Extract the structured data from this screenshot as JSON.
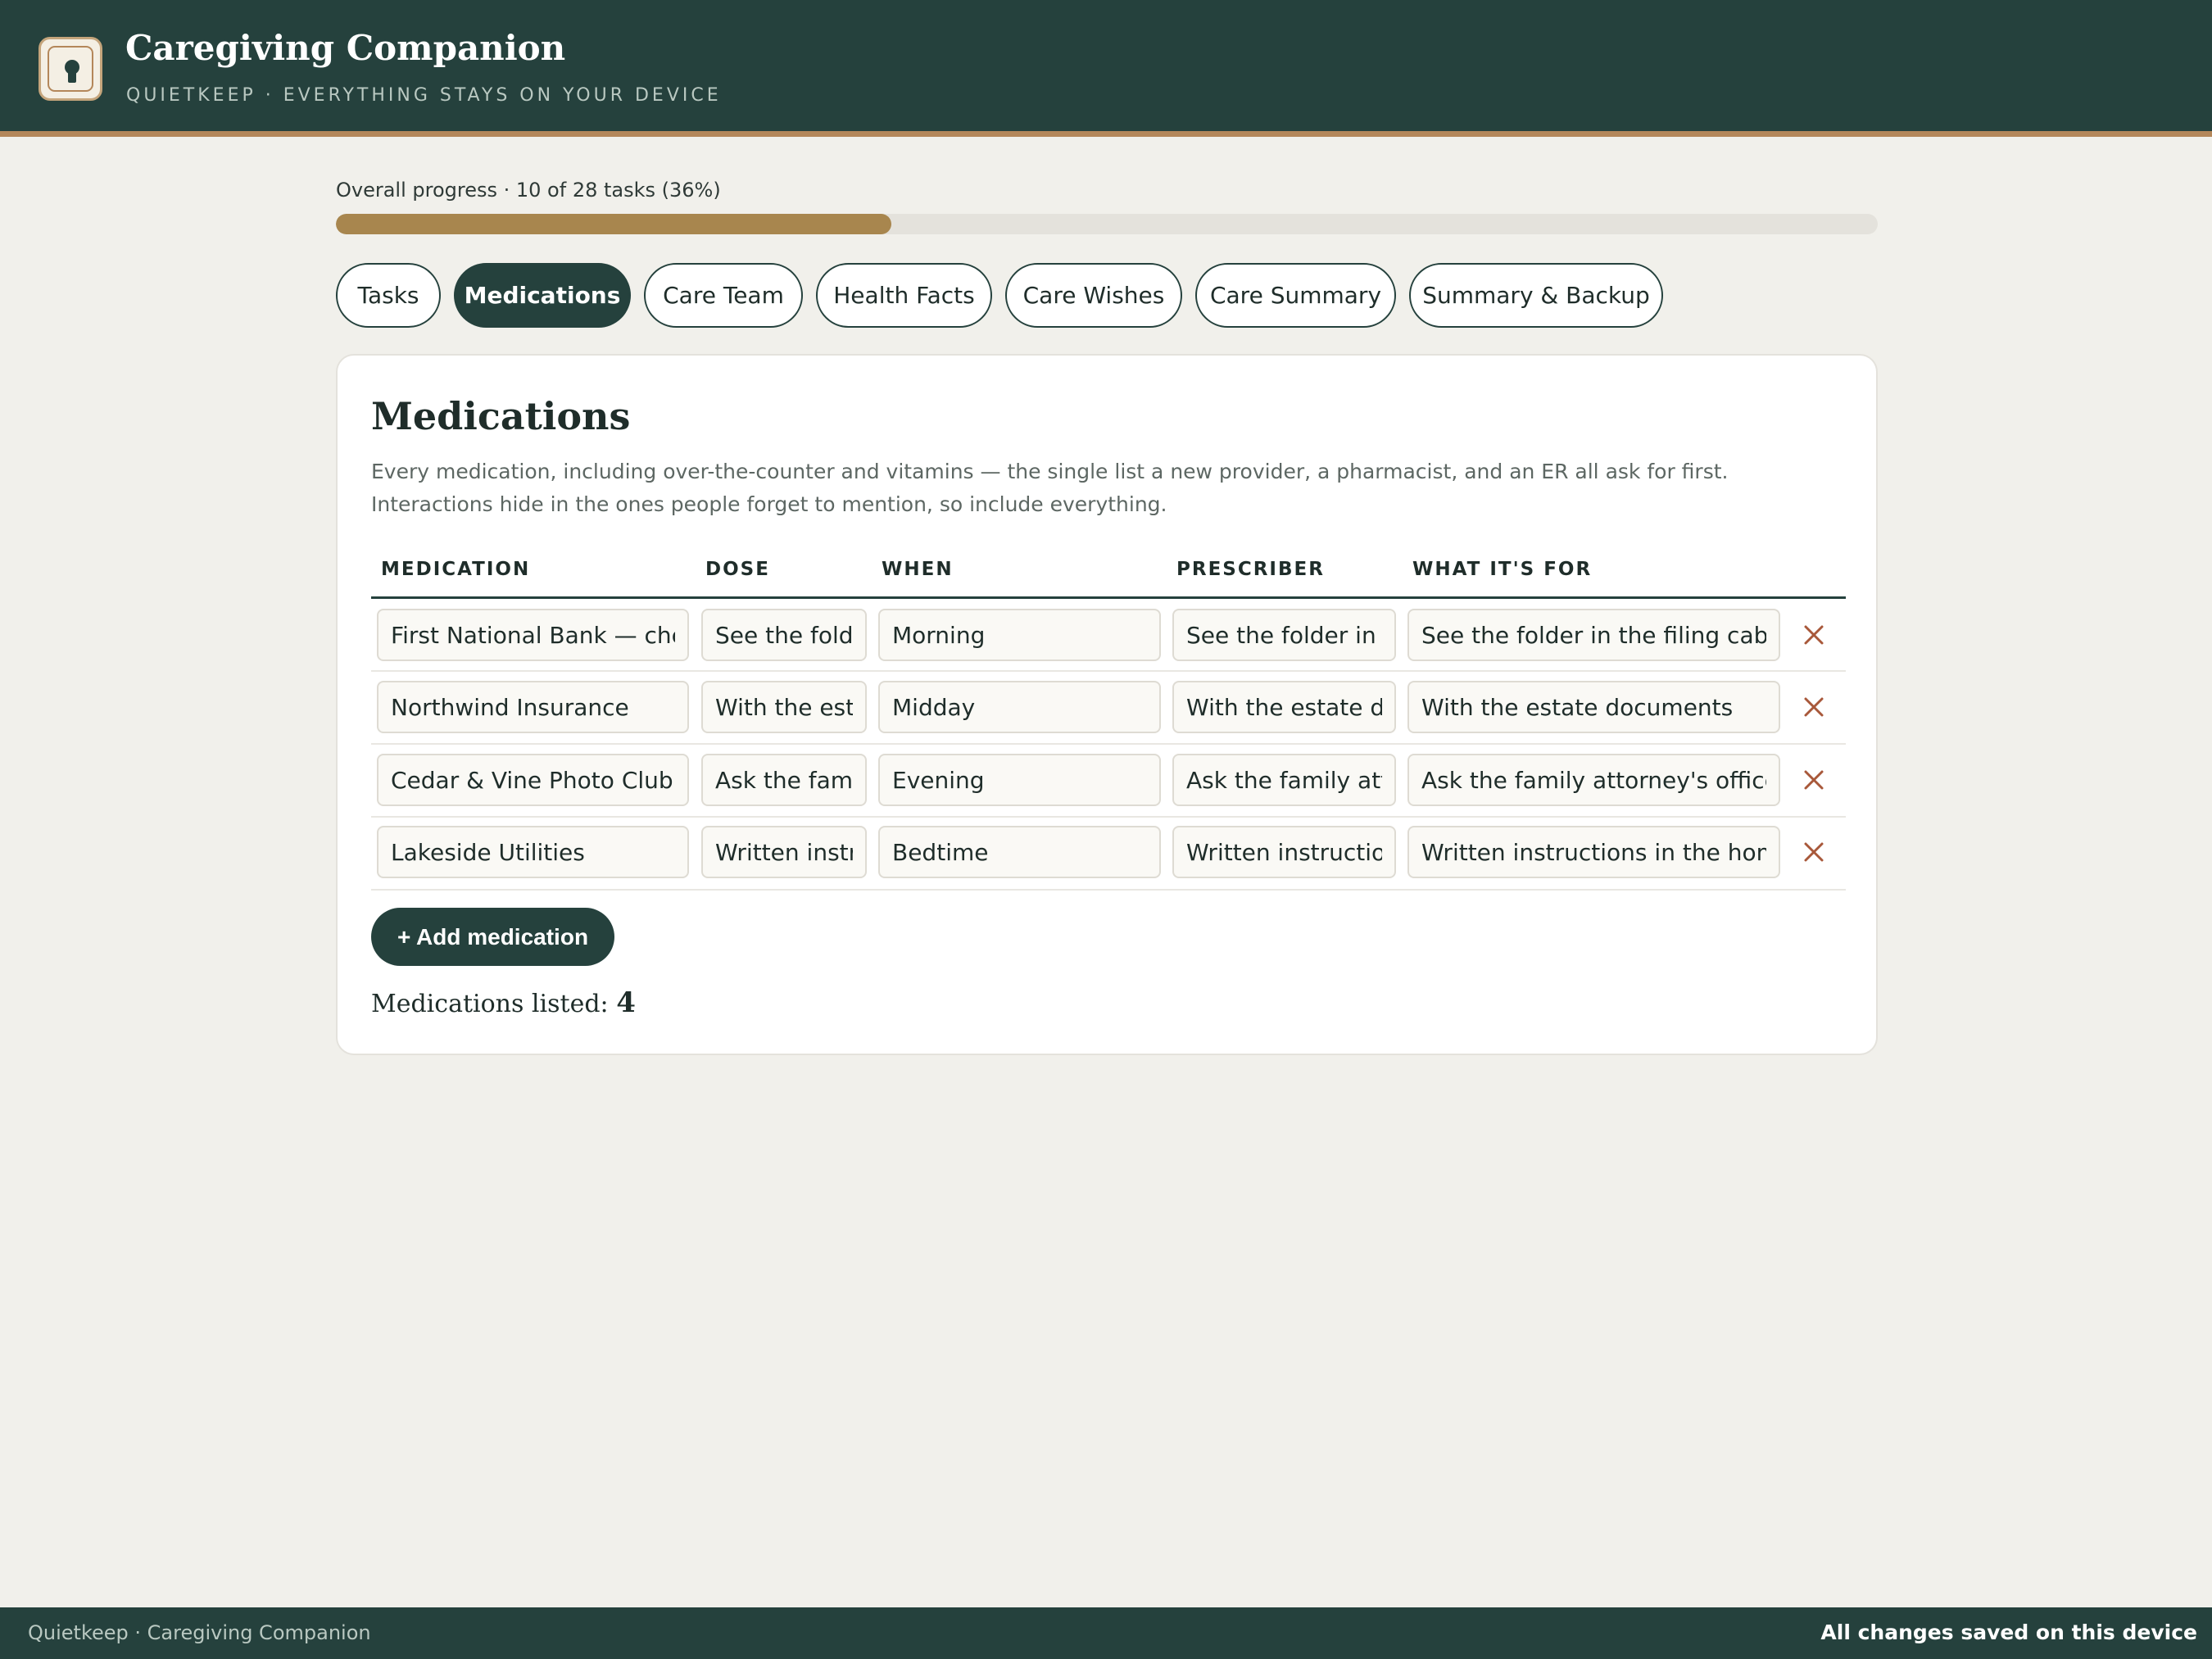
{
  "app": {
    "title": "Caregiving Companion",
    "subtitle": "QUIETKEEP · EVERYTHING STAYS ON YOUR DEVICE",
    "logo_icon": "keyhole-icon"
  },
  "progress": {
    "label": "Overall progress · 10 of 28 tasks (36%)",
    "completed": 10,
    "total": 28,
    "percent": 36
  },
  "tabs": [
    {
      "label": "Tasks",
      "active": false
    },
    {
      "label": "Medications",
      "active": true
    },
    {
      "label": "Care Team",
      "active": false
    },
    {
      "label": "Health Facts",
      "active": false
    },
    {
      "label": "Care Wishes",
      "active": false
    },
    {
      "label": "Care Summary",
      "active": false
    },
    {
      "label": "Summary & Backup",
      "active": false
    }
  ],
  "section": {
    "title": "Medications",
    "description": "Every medication, including over-the-counter and vitamins — the single list a new provider, a pharmacist, and an ER all ask for first. Interactions hide in the ones people forget to mention, so include everything.",
    "columns": [
      "MEDICATION",
      "DOSE",
      "WHEN",
      "PRESCRIBER",
      "WHAT IT'S FOR"
    ],
    "rows": [
      {
        "medication": "First National Bank — checking",
        "dose": "See the folder in the filing cabinet",
        "when": "Morning",
        "prescriber": "See the folder in the filing cabinet",
        "purpose": "See the folder in the filing cabinet"
      },
      {
        "medication": "Northwind Insurance",
        "dose": "With the estate documents",
        "when": "Midday",
        "prescriber": "With the estate documents",
        "purpose": "With the estate documents"
      },
      {
        "medication": "Cedar & Vine Photo Club",
        "dose": "Ask the family attorney's office",
        "when": "Evening",
        "prescriber": "Ask the family attorney's office",
        "purpose": "Ask the family attorney's office"
      },
      {
        "medication": "Lakeside Utilities",
        "dose": "Written instructions in the home safe",
        "when": "Bedtime",
        "prescriber": "Written instructions in the home safe",
        "purpose": "Written instructions in the home safe"
      }
    ],
    "remove_icon": "close-icon",
    "add_label": "+ Add medication",
    "count_label": "Medications listed:",
    "count": "4"
  },
  "footer": {
    "left": "Quietkeep · Caregiving Companion",
    "right": "All changes saved on this device"
  },
  "colors": {
    "header_bg": "#25413d",
    "accent": "#b4875a",
    "progress_fill": "#a8864e",
    "remove": "#a8583a",
    "background": "#f1f0eb"
  }
}
